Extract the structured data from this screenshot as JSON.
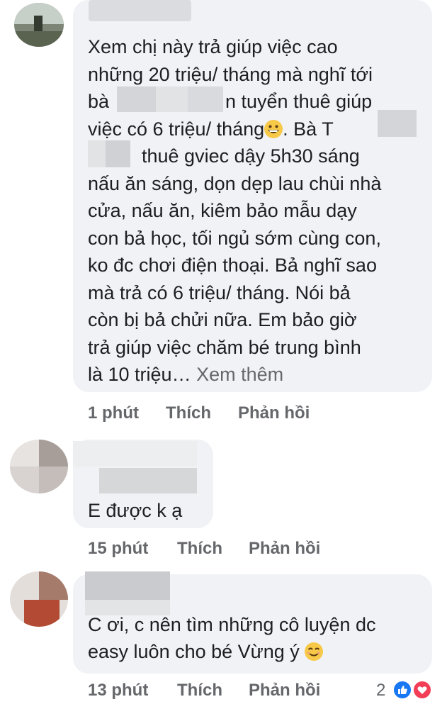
{
  "comments": [
    {
      "text_lines": [
        "Xem chị này trả giúp việc cao",
        "những 20 triệu/ tháng mà nghĩ tới",
        "bà",
        "n tuyển thuê giúp",
        "việc có 6 triệu/ tháng",
        ". Bà T",
        "thuê gviec dậy 5h30 sáng",
        "nấu ăn sáng, dọn dẹp lau chùi nhà",
        "cửa, nấu ăn, kiêm bảo mẫu dạy",
        "con bả học, tối ngủ sớm cùng con,",
        "ko đc chơi điện thoại. Bả nghĩ sao",
        "mà trả có 6 triệu/ tháng. Nói bả",
        "còn bị bả chửi nữa. Em bảo giờ",
        "trả giúp việc chăm bé trung bình",
        "là 10 triệu…"
      ],
      "see_more": "Xem thêm",
      "emoji": "grinning-face",
      "time": "1 phút",
      "like": "Thích",
      "reply": "Phản hồi"
    },
    {
      "text": "E được k ạ",
      "time": "15 phút",
      "like": "Thích",
      "reply": "Phản hồi"
    },
    {
      "text_lines": [
        "C ơi, c nên tìm những cô luyện dc",
        "easy luôn cho bé Vừng ý"
      ],
      "emoji": "smiling-face",
      "time": "13 phút",
      "like": "Thích",
      "reply": "Phản hồi",
      "reaction_count": "2",
      "reactions": [
        "like-reaction",
        "love-reaction"
      ]
    }
  ],
  "colors": {
    "bubble": "#f0f2f5",
    "meta": "#65676b",
    "like_blue": "#1877f2",
    "love_red": "#f33e58"
  }
}
